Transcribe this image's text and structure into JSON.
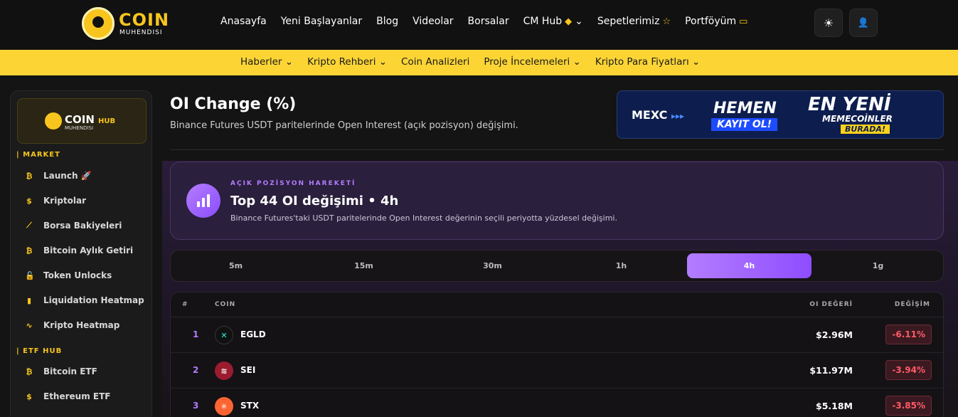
{
  "brand": {
    "name": "COIN",
    "sub": "MUHENDISI"
  },
  "nav": {
    "items": [
      {
        "label": "Anasayfa",
        "icon": ""
      },
      {
        "label": "Yeni Başlayanlar",
        "icon": ""
      },
      {
        "label": "Blog",
        "icon": ""
      },
      {
        "label": "Videolar",
        "icon": ""
      },
      {
        "label": "Borsalar",
        "icon": ""
      },
      {
        "label": "CM Hub",
        "icon": "◆",
        "chevron": "⌄"
      },
      {
        "label": "Sepetlerimiz",
        "icon": "☆"
      },
      {
        "label": "Portföyüm",
        "icon": "▭"
      }
    ],
    "theme_icon": "☀",
    "user_icon": "👤"
  },
  "subnav": {
    "items": [
      {
        "label": "Haberler ⌄"
      },
      {
        "label": "Kripto Rehberi ⌄"
      },
      {
        "label": "Coin Analizleri"
      },
      {
        "label": "Proje İncelemeleri ⌄"
      },
      {
        "label": "Kripto Para Fiyatları ⌄"
      }
    ]
  },
  "sidebar": {
    "hub_card": {
      "coin": "COIN",
      "sub": "MUHENDISI",
      "hub": "HUB"
    },
    "sections": [
      {
        "label": "| MARKET"
      },
      {
        "label": "| ETF HUB"
      }
    ],
    "items": [
      {
        "label": "Launch 🚀",
        "icon": "₿"
      },
      {
        "label": "Kriptolar",
        "icon": "$"
      },
      {
        "label": "Borsa Bakiyeleri",
        "icon": "⟋"
      },
      {
        "label": "Bitcoin Aylık Getiri",
        "icon": "₿"
      },
      {
        "label": "Token Unlocks",
        "icon": "🔓"
      },
      {
        "label": "Liquidation Heatmap",
        "icon": "▮"
      },
      {
        "label": "Kripto Heatmap",
        "icon": "∿"
      },
      {
        "label": "Bitcoin ETF",
        "icon": "₿"
      },
      {
        "label": "Ethereum ETF",
        "icon": "$"
      }
    ]
  },
  "page": {
    "title": "OI Change (%)",
    "description": "Binance Futures USDT paritelerinde Open Interest (açık pozisyon) değişimi."
  },
  "banner": {
    "mexc": "MEXC",
    "arrows": "▸▸▸",
    "hemen": "HEMEN",
    "kayit": "KAYIT OL!",
    "en_yeni": "EN YENİ",
    "memecoin": "MEMECOİNLER",
    "burada": "BURADA!"
  },
  "hero": {
    "eyebrow": "AÇIK POZİSYON HAREKETİ",
    "title": "Top 44 OI değişimi • 4h",
    "description": "Binance Futures'taki USDT paritelerinde Open Interest değerinin seçili periyotta yüzdesel değişimi."
  },
  "tabs": {
    "items": [
      {
        "label": "5m"
      },
      {
        "label": "15m"
      },
      {
        "label": "30m"
      },
      {
        "label": "1h"
      },
      {
        "label": "4h"
      },
      {
        "label": "1g"
      }
    ],
    "active": "4h"
  },
  "table": {
    "headers": {
      "rank": "#",
      "coin": "COIN",
      "oi": "OI DEĞERİ",
      "change": "DEĞİŞİM"
    },
    "rows": [
      {
        "rank": "1",
        "coin": "EGLD",
        "oi": "$2.96M",
        "change": "-6.11%",
        "icon_color": "#111",
        "icon_fg": "#23f7dd",
        "glyph": "✕"
      },
      {
        "rank": "2",
        "coin": "SEI",
        "oi": "$11.97M",
        "change": "-3.94%",
        "icon_color": "#9b1c2e",
        "icon_fg": "#ffffff",
        "glyph": "≋"
      },
      {
        "rank": "3",
        "coin": "STX",
        "oi": "$5.18M",
        "change": "-3.85%",
        "icon_color": "#fc6432",
        "icon_fg": "#ffffff",
        "glyph": "✳"
      }
    ]
  }
}
